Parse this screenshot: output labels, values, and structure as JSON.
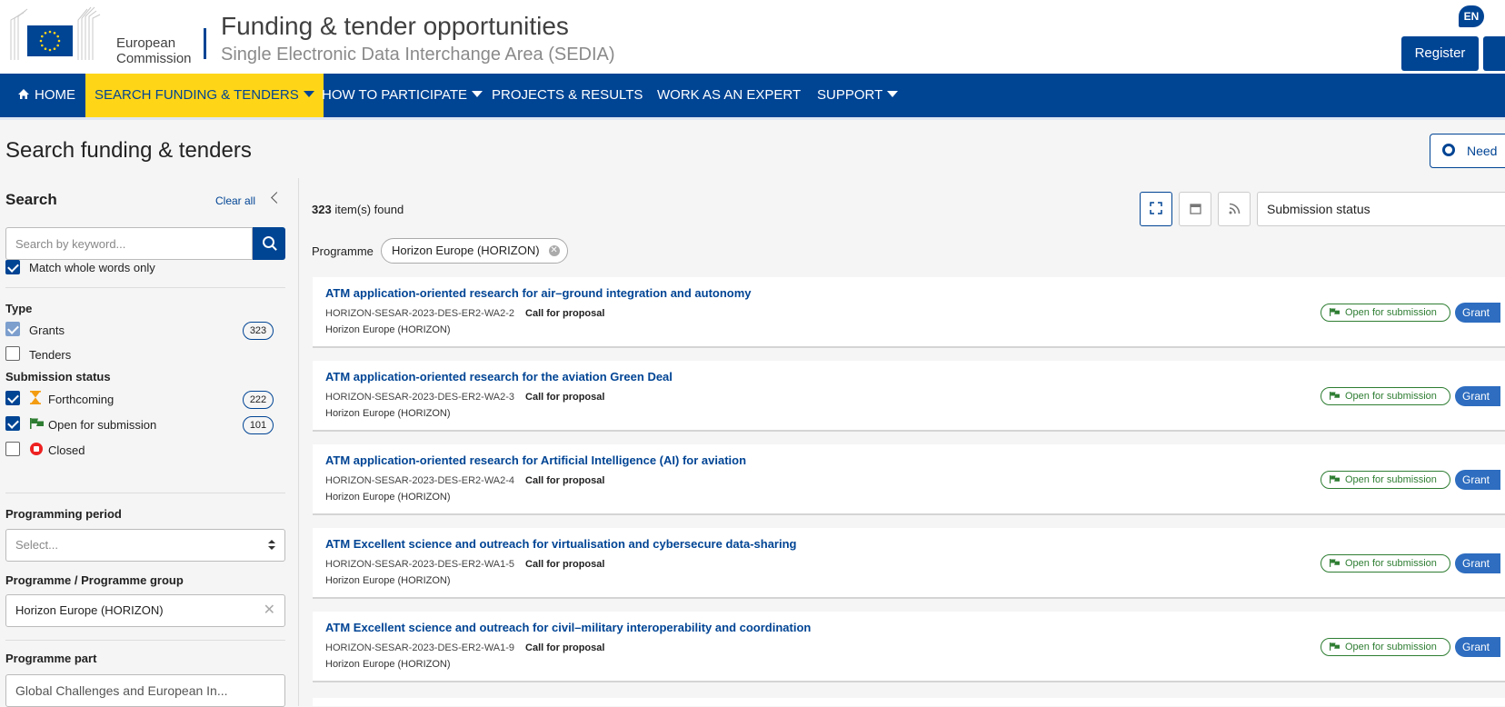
{
  "header": {
    "logo_line1": "European",
    "logo_line2": "Commission",
    "title": "Funding & tender opportunities",
    "subtitle": "Single Electronic Data Interchange Area (SEDIA)",
    "language": "EN",
    "register_label": "Register"
  },
  "nav": {
    "home": "HOME",
    "search": "SEARCH FUNDING & TENDERS",
    "participate": "HOW TO PARTICIPATE",
    "projects": "PROJECTS & RESULTS",
    "expert": "WORK AS AN EXPERT",
    "support": "SUPPORT"
  },
  "page": {
    "title": "Search funding & tenders",
    "need_help": "Need"
  },
  "sidebar": {
    "heading": "Search",
    "clear_all": "Clear all",
    "search_placeholder": "Search by keyword...",
    "match_whole_words": "Match whole words only",
    "type_heading": "Type",
    "grants_label": "Grants",
    "grants_count": "323",
    "tenders_label": "Tenders",
    "status_heading": "Submission status",
    "forthcoming_label": "Forthcoming",
    "forthcoming_count": "222",
    "open_label": "Open for submission",
    "open_count": "101",
    "closed_label": "Closed",
    "period_heading": "Programming period",
    "period_placeholder": "Select...",
    "programme_heading": "Programme / Programme group",
    "programme_value": "Horizon Europe (HORIZON)",
    "part_heading": "Programme part",
    "part_value": "Global Challenges and European In..."
  },
  "results": {
    "count": "323",
    "count_suffix": " item(s) found",
    "sort_label": "Submission status",
    "filter_label": "Programme",
    "filter_chip": "Horizon Europe (HORIZON)",
    "items": [
      {
        "title": "ATM application-oriented research for air–ground integration and autonomy",
        "id": "HORIZON-SESAR-2023-DES-ER2-WA2-2",
        "kind": "Call for proposal",
        "programme": "Horizon Europe (HORIZON)",
        "status": "Open for submission",
        "type": "Grant"
      },
      {
        "title": "ATM application-oriented research for the aviation Green Deal",
        "id": "HORIZON-SESAR-2023-DES-ER2-WA2-3",
        "kind": "Call for proposal",
        "programme": "Horizon Europe (HORIZON)",
        "status": "Open for submission",
        "type": "Grant"
      },
      {
        "title": "ATM application-oriented research for Artificial Intelligence (AI) for aviation",
        "id": "HORIZON-SESAR-2023-DES-ER2-WA2-4",
        "kind": "Call for proposal",
        "programme": "Horizon Europe (HORIZON)",
        "status": "Open for submission",
        "type": "Grant"
      },
      {
        "title": "ATM Excellent science and outreach for virtualisation and cybersecure data-sharing",
        "id": "HORIZON-SESAR-2023-DES-ER2-WA1-5",
        "kind": "Call for proposal",
        "programme": "Horizon Europe (HORIZON)",
        "status": "Open for submission",
        "type": "Grant"
      },
      {
        "title": "ATM Excellent science and outreach for civil–military interoperability and coordination",
        "id": "HORIZON-SESAR-2023-DES-ER2-WA1-9",
        "kind": "Call for proposal",
        "programme": "Horizon Europe (HORIZON)",
        "status": "Open for submission",
        "type": "Grant"
      }
    ]
  },
  "colors": {
    "brand_blue": "#004494",
    "accent_yellow": "#ffd617",
    "status_green": "#2e7d32",
    "grant_blue": "#2e6dc0",
    "forthcoming_orange": "#f39c12",
    "closed_red": "#e22222"
  },
  "icons": [
    "home-icon",
    "caret-down-icon",
    "search-icon",
    "lifebuoy-icon",
    "hourglass-icon",
    "flag-icon",
    "closed-icon",
    "expand-icon",
    "calendar-icon",
    "rss-icon",
    "chevron-left-icon",
    "clear-icon"
  ]
}
